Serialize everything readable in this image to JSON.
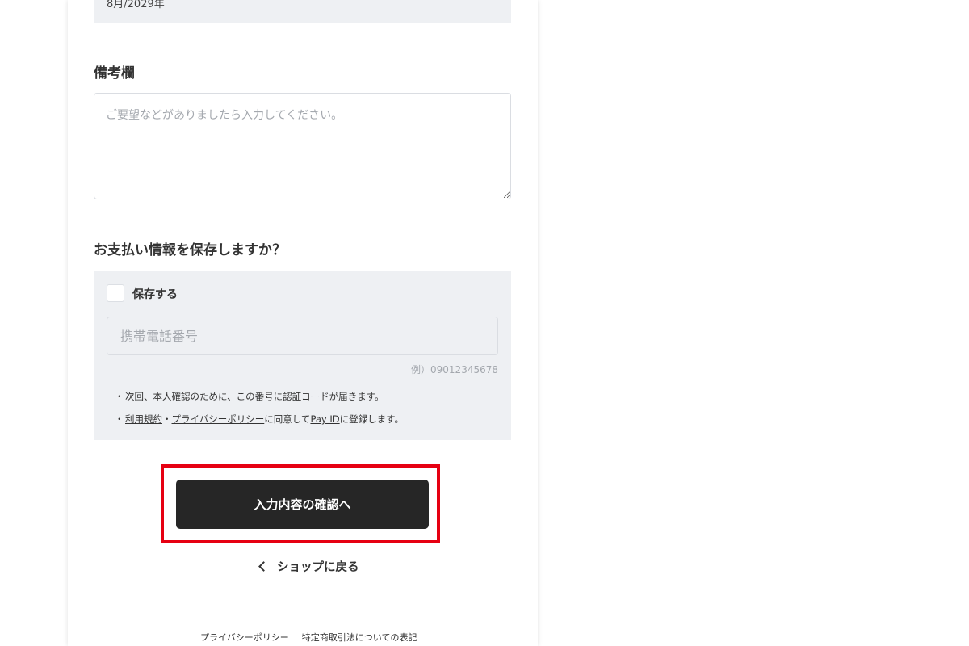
{
  "card_expiry": {
    "value": "8月/2029年"
  },
  "memo_section": {
    "title": "備考欄",
    "placeholder": "ご要望などがありましたら入力してください。"
  },
  "save_payment_section": {
    "title": "お支払い情報を保存しますか？",
    "checkbox_label": "保存する",
    "phone_placeholder": "携帯電話番号",
    "phone_example": "例）09012345678",
    "notes": [
      {
        "bullet": "・",
        "text": "次回、本人確認のために、この番号に認証コードが届きます。"
      },
      {
        "bullet": "・",
        "terms_link": "利用規約",
        "separator": "・",
        "privacy_link": "プライバシーポリシー",
        "middle_text": "に同意して",
        "payid_link": "Pay ID",
        "end_text": "に登録します。"
      }
    ]
  },
  "actions": {
    "confirm_label": "入力内容の確認へ",
    "back_label": "ショップに戻る"
  },
  "footer": {
    "privacy_policy": "プライバシーポリシー",
    "commercial_law": "特定商取引法についての表記"
  },
  "colors": {
    "panel_bg": "#eef0f3",
    "button_bg": "#262626",
    "highlight": "#e60012"
  }
}
